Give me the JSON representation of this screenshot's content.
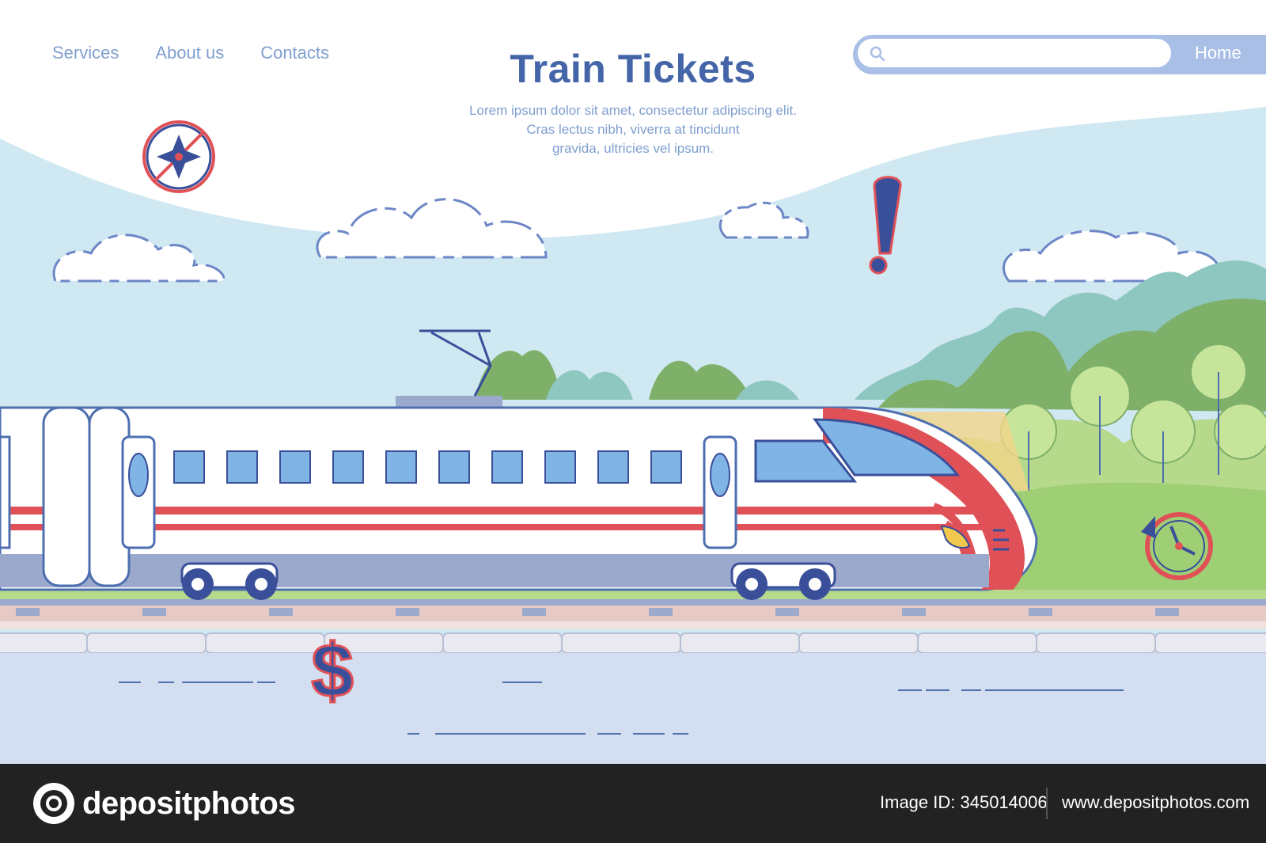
{
  "nav": {
    "items": [
      {
        "label": "Services"
      },
      {
        "label": "About us"
      },
      {
        "label": "Contacts"
      }
    ],
    "home_label": "Home"
  },
  "hero": {
    "title": "Train Tickets",
    "subtitle_lines": [
      "Lorem ipsum dolor sit amet, consectetur adipiscing elit.",
      "Cras lectus nibh, viverra at tincidunt",
      "gravida, ultricies vel ipsum."
    ]
  },
  "search": {
    "placeholder": "",
    "icon": "search-icon"
  },
  "illustration": {
    "icons": [
      "compass-icon",
      "exclamation-icon",
      "clock-icon",
      "dollar-icon"
    ],
    "colors": {
      "sky": "#cde8f3",
      "sky_top": "#ffffff",
      "ground": "#d3def0",
      "train_body": "#ffffff",
      "train_stripe": "#e05157",
      "train_window": "#7fb4e4",
      "trees_dark": "#7fb06a",
      "trees_light": "#b6d98c",
      "accent_blue": "#3a4f9a",
      "accent_red": "#e05157"
    }
  },
  "footer": {
    "logo_text": "depositphotos",
    "image_id": "Image ID: 345014006",
    "website": "www.depositphotos.com"
  }
}
